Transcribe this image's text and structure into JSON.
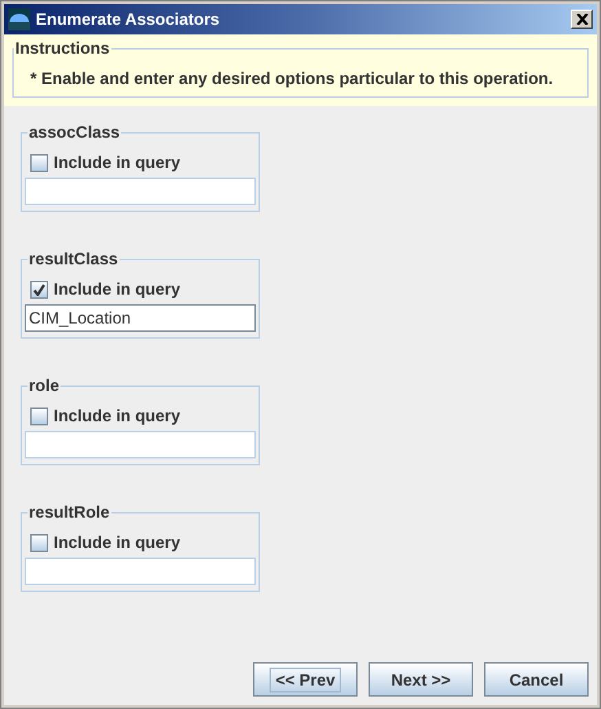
{
  "window": {
    "title": "Enumerate Associators"
  },
  "instructions": {
    "title": "Instructions",
    "text": "* Enable and enter any desired options particular to this operation."
  },
  "groups": [
    {
      "title": "assocClass",
      "checkbox": {
        "label": "Include in query",
        "checked": false
      }
    },
    {
      "title": "resultClass",
      "checkbox": {
        "label": "Include in query",
        "checked": true
      },
      "value": "CIM_Location"
    },
    {
      "title": "role",
      "checkbox": {
        "label": "Include in query",
        "checked": false
      }
    },
    {
      "title": "resultRole",
      "checkbox": {
        "label": "Include in query",
        "checked": false
      }
    }
  ],
  "buttons": [
    {
      "label": "<< Prev",
      "focused": true
    },
    {
      "label": "Next >>",
      "focused": false
    },
    {
      "label": "Cancel",
      "focused": false
    }
  ]
}
